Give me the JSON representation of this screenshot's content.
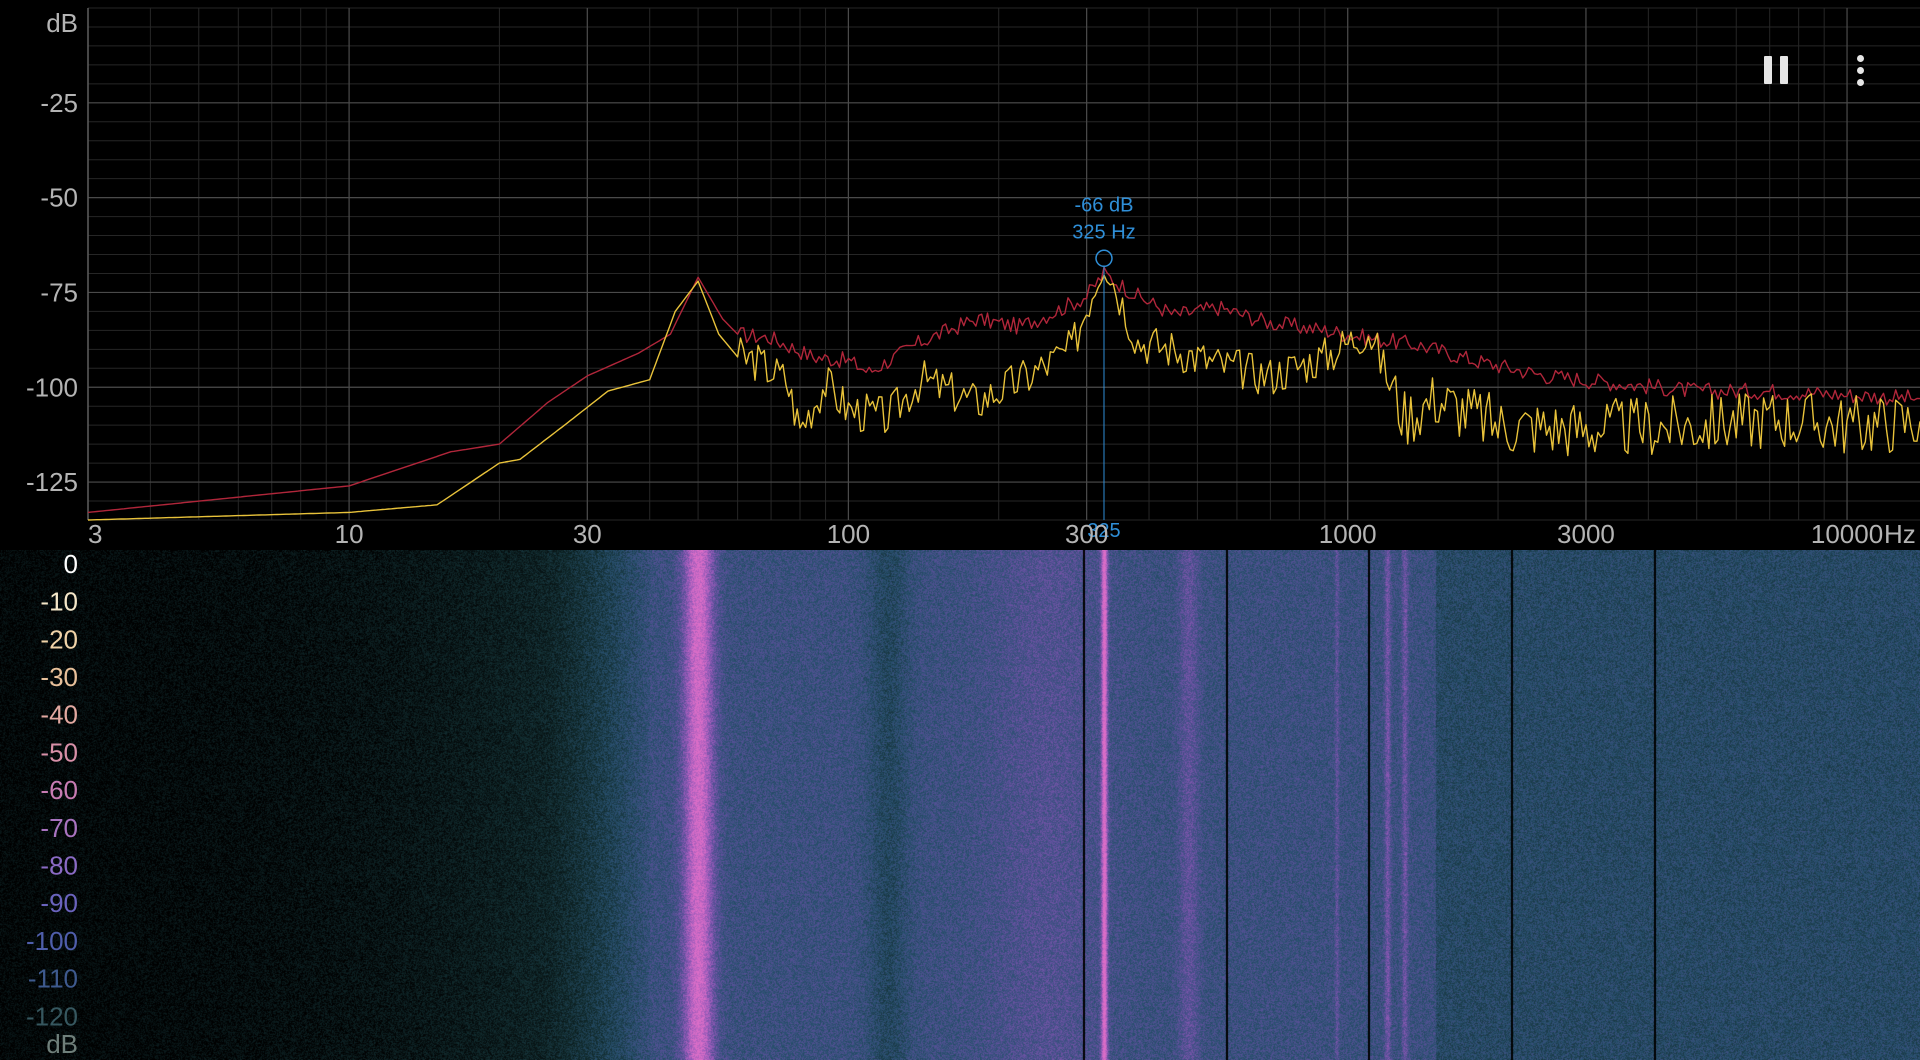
{
  "spectrum": {
    "db_unit": "dB",
    "hz_unit": "Hz",
    "db_ticks": [
      "-25",
      "-50",
      "-75",
      "-100",
      "-125"
    ],
    "freq_ticks": [
      "3",
      "10",
      "30",
      "100",
      "300",
      "1000",
      "3000",
      "10000"
    ],
    "cursor": {
      "db_label": "-66 dB",
      "hz_label": "325 Hz",
      "axis_label": "325",
      "freq_hz": 325,
      "db": -66
    },
    "colors": {
      "peak_hold": "#b0263a",
      "live": "#e8c23a",
      "cursor": "#2f8fd8",
      "grid": "#3a3a3a",
      "axis_text": "#b4b4b4"
    }
  },
  "spectrogram": {
    "db_unit": "dB",
    "legend_ticks": [
      "0",
      "-10",
      "-20",
      "-30",
      "-40",
      "-50",
      "-60",
      "-70",
      "-80",
      "-90",
      "-100",
      "-110",
      "-120"
    ]
  },
  "controls": {
    "pause_icon": "pause-icon",
    "menu_icon": "more-vert-icon"
  },
  "chart_data": {
    "type": "line",
    "xscale": "log",
    "xlabel": "Hz",
    "ylabel": "dB",
    "xlim": [
      3,
      14000
    ],
    "ylim": [
      -135,
      0
    ],
    "x_ticks": [
      3,
      10,
      30,
      100,
      300,
      1000,
      3000,
      10000
    ],
    "y_ticks": [
      -25,
      -50,
      -75,
      -100,
      -125
    ],
    "grid": true,
    "series": [
      {
        "color": "#b0263a",
        "x": [
          3,
          10,
          16,
          20,
          25,
          30,
          38,
          44,
          50,
          56,
          60,
          70,
          85,
          100,
          110,
          140,
          180,
          220,
          260,
          300,
          325,
          380,
          450,
          550,
          700,
          900,
          1100,
          1400,
          1800,
          2500,
          3500,
          5000,
          7000,
          10000,
          14000
        ],
        "y": [
          -133,
          -126,
          -117,
          -115,
          -104,
          -97,
          -91,
          -86,
          -71,
          -82,
          -86,
          -87,
          -92,
          -93,
          -96,
          -88,
          -82,
          -84,
          -80,
          -76,
          -70,
          -76,
          -81,
          -79,
          -83,
          -85,
          -87,
          -89,
          -93,
          -97,
          -99,
          -101,
          -101,
          -102,
          -103
        ]
      },
      {
        "color": "#e8c23a",
        "x": [
          3,
          10,
          15,
          20,
          22,
          27,
          33,
          40,
          45,
          50,
          55,
          60,
          65,
          75,
          80,
          90,
          100,
          120,
          140,
          180,
          230,
          280,
          325,
          380,
          450,
          550,
          700,
          900,
          1100,
          1300,
          1500,
          2000,
          3000,
          5000,
          7000,
          10000,
          14000
        ],
        "y": [
          -135,
          -133,
          -131,
          -120,
          -119,
          -110,
          -101,
          -98,
          -80,
          -72,
          -86,
          -92,
          -93,
          -98,
          -111,
          -99,
          -106,
          -108,
          -98,
          -104,
          -97,
          -90,
          -66,
          -88,
          -90,
          -94,
          -97,
          -92,
          -85,
          -108,
          -103,
          -110,
          -111,
          -110,
          -108,
          -110,
          -109
        ]
      }
    ]
  }
}
